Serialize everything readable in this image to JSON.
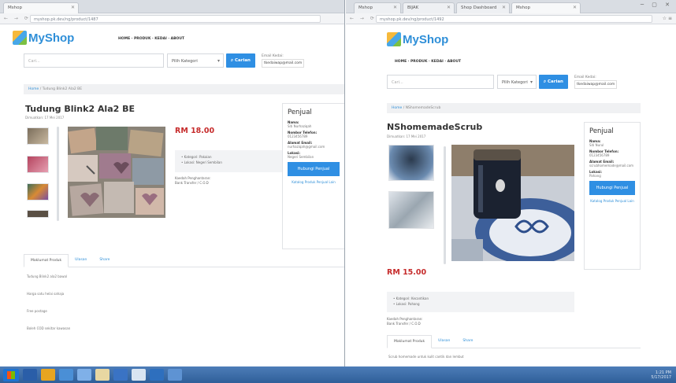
{
  "colors": {
    "brand": "#2f8fd8",
    "button": "#2f8fe3",
    "price": "#c62b2b",
    "taskbar": "#3a6aa8"
  },
  "left": {
    "tab_title": "Mshop",
    "url": "myshop.pk.dev/ng/product/1487",
    "logo_text": "MyShop",
    "nav": "HOME  ·  PRODUK  ·  KEDAI  ·  ABOUT",
    "search_placeholder": "Cari...",
    "category_label": "Pilih Kategori",
    "search_button": "Carian",
    "email_label": "Email Kedai:",
    "email_value": "tkedaiwap@mail.com",
    "breadcrumb_home": "Home",
    "breadcrumb_current": "Tudung Blink2 Ala2 BE",
    "title": "Tudung Blink2 Ala2 BE",
    "date": "Dimuatkan: 17 Mei 2017",
    "price": "RM 18.00",
    "info": [
      "Kategori: Pakaian",
      "Lokasi: Negeri Sembilan"
    ],
    "ship": [
      "Kaedah Penghantaran:",
      "Bank Transfer / C.O.D"
    ],
    "seller": {
      "title": "Penjual",
      "name_label": "Nama:",
      "name_value": "Siti Nurhaziqah",
      "phone_label": "Nombor Telefon:",
      "phone_value": "0123456789",
      "email_label": "Alamat Email:",
      "email_value": "nurhaziqah@gmail.com",
      "loc_label": "Lokasi:",
      "loc_value": "Negeri Sembilan",
      "button": "Hubungi Penjual",
      "more": "Katalog Produk Penjual Lain"
    },
    "tabs": [
      "Maklumat Produk",
      "Ulasan",
      "Share"
    ],
    "desc": [
      "Tudung Blink2 ala2 bawal",
      "Harga satu helai sahaja",
      "Free postage",
      "Boleh COD sekitar kawasan"
    ]
  },
  "right": {
    "tabs": [
      "Mshop",
      "BIJAK",
      "Shop Dashboard",
      "Mshop"
    ],
    "url": "myshop.pk.dev/ng/product/1492",
    "logo_text": "MyShop",
    "nav": "HOME  ·  PRODUK  ·  KEDAI  ·  ABOUT",
    "search_placeholder": "Cari...",
    "category_label": "Pilih Kategori",
    "search_button": "Carian",
    "email_label": "Email Kedai:",
    "email_value": "tkedaiwap@mail.com",
    "breadcrumb_home": "Home",
    "breadcrumb_current": "NShomemadeScrub",
    "title": "NShomemadeScrub",
    "date": "Dimuatkan: 17 Mei 2017",
    "price": "RM 15.00",
    "info": [
      "Kategori: Kecantikan",
      "Lokasi: Pahang"
    ],
    "ship": [
      "Kaedah Penghantaran:",
      "Bank Transfer / C.O.D"
    ],
    "seller": {
      "title": "Penjual",
      "name_label": "Nama:",
      "name_value": "Siti Nurul",
      "phone_label": "Nombor Telefon:",
      "phone_value": "0123456789",
      "email_label": "Alamat Email:",
      "email_value": "scrubhomemade@mail.com",
      "loc_label": "Lokasi:",
      "loc_value": "Pahang",
      "button": "Hubungi Penjual",
      "more": "Katalog Produk Penjual Lain"
    },
    "tabs_bottom": [
      "Maklumat Produk",
      "Ulasan",
      "Share"
    ],
    "desc": [
      "Scrub homemade untuk kulit cantik dan lembut"
    ]
  },
  "taskbar": {
    "time": "1:21 PM",
    "date": "5/17/2017"
  }
}
